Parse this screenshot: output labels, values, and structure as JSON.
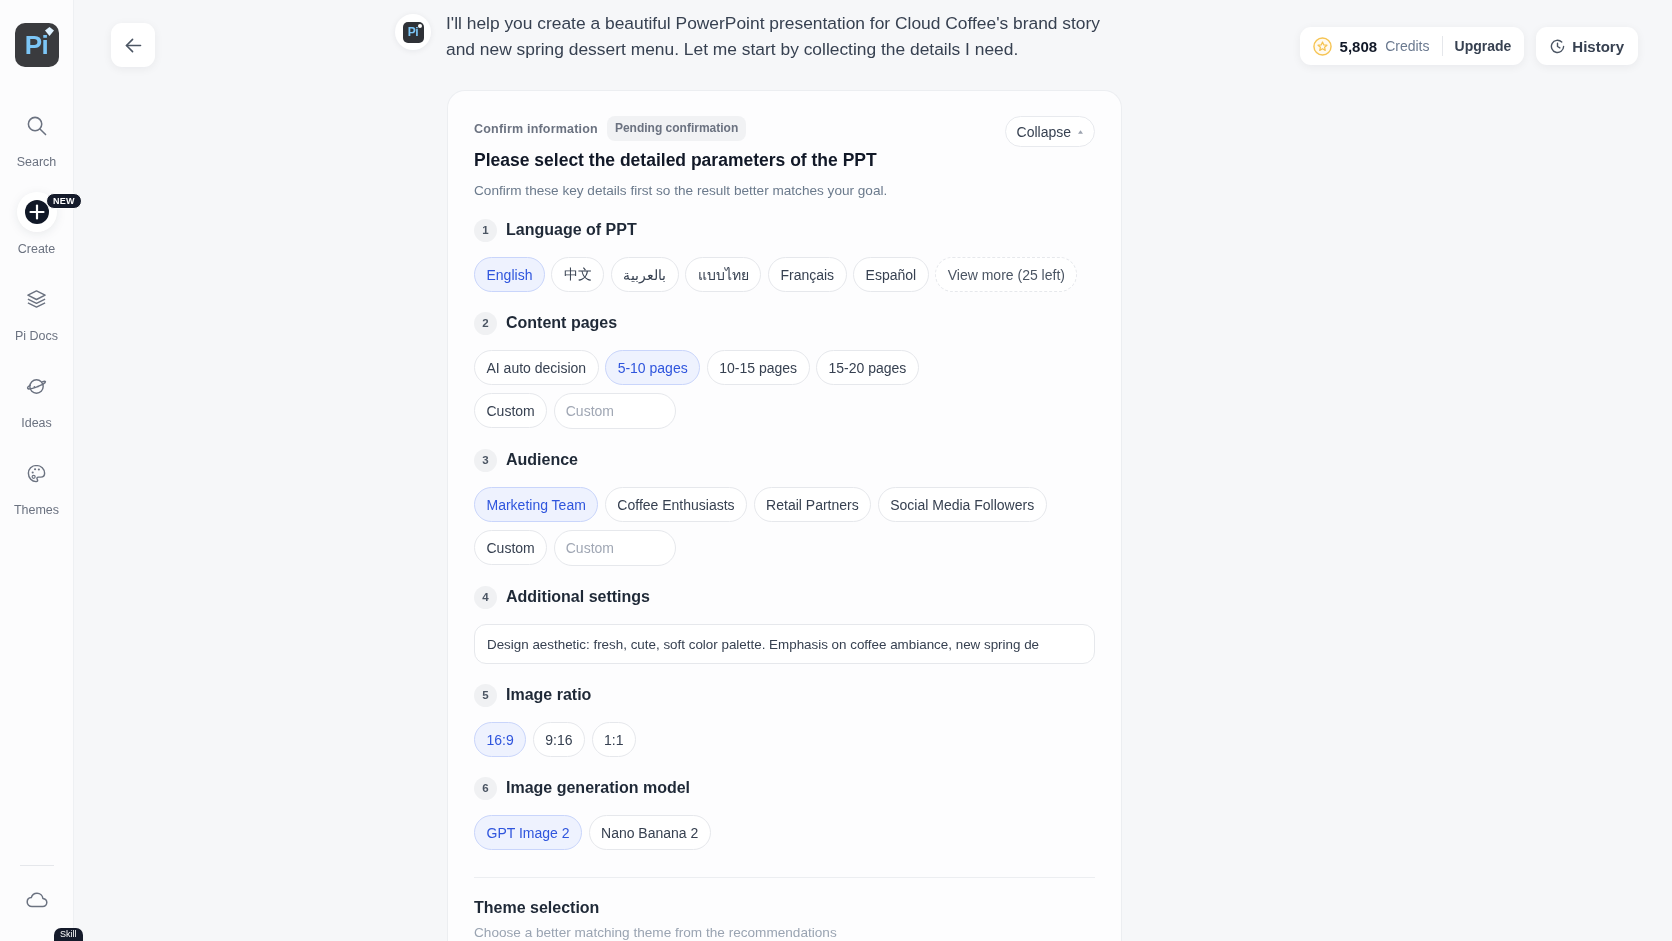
{
  "sidebar": {
    "logo": "Pi",
    "items": [
      {
        "label": "Search"
      },
      {
        "label": "Create",
        "badge": "NEW"
      },
      {
        "label": "Pi Docs"
      },
      {
        "label": "Ideas"
      },
      {
        "label": "Themes"
      }
    ],
    "footer_badge": "Skill"
  },
  "chat": {
    "avatar_logo": "Pi",
    "message": "I'll help you create a beautiful PowerPoint presentation for Cloud Coffee's brand story and new spring dessert menu. Let me start by collecting the details I need."
  },
  "credits": {
    "amount": "5,808",
    "label": "Credits",
    "upgrade_button": "Upgrade"
  },
  "history_button": "History",
  "card": {
    "label": "Confirm information",
    "status": "Pending confirmation",
    "collapse_button": "Collapse",
    "title": "Please select the detailed parameters of the PPT",
    "subtitle": "Confirm these key details first so the result better matches your goal.",
    "sections": [
      {
        "number": "1",
        "heading": "Language of PPT",
        "kind": "chips",
        "options": [
          {
            "label": "English",
            "selected": true
          },
          {
            "label": "中文",
            "selected": false
          },
          {
            "label": "بالعربية",
            "selected": false
          },
          {
            "label": "แบบไทย",
            "selected": false
          },
          {
            "label": "Français",
            "selected": false
          },
          {
            "label": "Español",
            "selected": false
          }
        ],
        "more_button": "View more (25 left)"
      },
      {
        "number": "2",
        "heading": "Content pages",
        "kind": "chips",
        "options": [
          {
            "label": "AI auto decision",
            "selected": false
          },
          {
            "label": "5-10 pages",
            "selected": true
          },
          {
            "label": "10-15 pages",
            "selected": false
          },
          {
            "label": "15-20 pages",
            "selected": false
          }
        ],
        "custom": {
          "label": "Custom",
          "selected": false,
          "placeholder": "Custom"
        }
      },
      {
        "number": "3",
        "heading": "Audience",
        "kind": "chips",
        "options": [
          {
            "label": "Marketing Team",
            "selected": true
          },
          {
            "label": "Coffee Enthusiasts",
            "selected": false
          },
          {
            "label": "Retail Partners",
            "selected": false
          },
          {
            "label": "Social Media Followers",
            "selected": false
          }
        ],
        "custom": {
          "label": "Custom",
          "selected": false,
          "placeholder": "Custom"
        }
      },
      {
        "number": "4",
        "heading": "Additional settings",
        "kind": "text",
        "value": "Design aesthetic: fresh, cute, soft color palette. Emphasis on coffee ambiance, new spring de"
      },
      {
        "number": "5",
        "heading": "Image ratio",
        "kind": "chips",
        "options": [
          {
            "label": "16:9",
            "selected": true
          },
          {
            "label": "9:16",
            "selected": false
          },
          {
            "label": "1:1",
            "selected": false
          }
        ]
      },
      {
        "number": "6",
        "heading": "Image generation model",
        "kind": "chips",
        "options": [
          {
            "label": "GPT Image 2",
            "selected": true
          },
          {
            "label": "Nano Banana 2",
            "selected": false
          }
        ]
      }
    ],
    "theme": {
      "heading": "Theme selection",
      "description": "Choose a better matching theme from the recommendations"
    }
  }
}
